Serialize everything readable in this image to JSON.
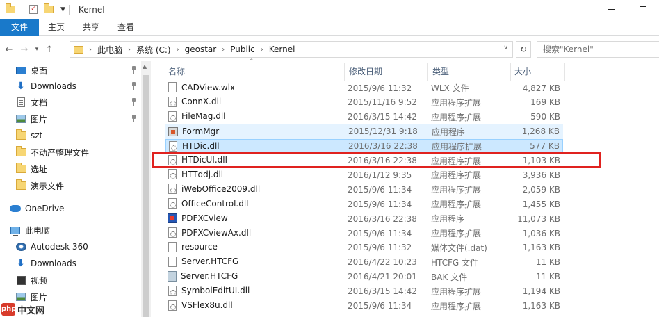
{
  "window": {
    "title": "Kernel"
  },
  "ribbon": {
    "tabs": [
      "文件",
      "主页",
      "共享",
      "查看"
    ]
  },
  "address": {
    "crumbs": [
      "此电脑",
      "系统 (C:)",
      "geostar",
      "Public",
      "Kernel"
    ],
    "search_placeholder": "搜索\"Kernel\""
  },
  "nav": {
    "items": [
      {
        "label": "桌面",
        "icon": "desktop-icon",
        "pinned": true
      },
      {
        "label": "Downloads",
        "icon": "download-icon",
        "pinned": true
      },
      {
        "label": "文档",
        "icon": "document-icon",
        "pinned": true
      },
      {
        "label": "图片",
        "icon": "pictures-icon",
        "pinned": true
      },
      {
        "label": "szt",
        "icon": "folder-icon",
        "pinned": false
      },
      {
        "label": "不动产整理文件",
        "icon": "folder-icon",
        "pinned": false
      },
      {
        "label": "选址",
        "icon": "folder-icon",
        "pinned": false
      },
      {
        "label": "演示文件",
        "icon": "folder-icon",
        "pinned": false
      },
      {
        "label": "OneDrive",
        "icon": "onedrive-icon",
        "pinned": false
      },
      {
        "label": "此电脑",
        "icon": "this-pc-icon",
        "pinned": false
      },
      {
        "label": "Autodesk 360",
        "icon": "autodesk-icon",
        "pinned": false
      },
      {
        "label": "Downloads",
        "icon": "download-icon",
        "pinned": false
      },
      {
        "label": "视频",
        "icon": "video-icon",
        "pinned": false
      },
      {
        "label": "图片",
        "icon": "pictures-icon",
        "pinned": false
      }
    ]
  },
  "columns": {
    "name": "名称",
    "date": "修改日期",
    "type": "类型",
    "size": "大小"
  },
  "files": [
    {
      "name": "CADView.wlx",
      "date": "2015/9/6 11:32",
      "type": "WLX 文件",
      "size": "4,827 KB",
      "icon": "file"
    },
    {
      "name": "ConnX.dll",
      "date": "2015/11/16 9:52",
      "type": "应用程序扩展",
      "size": "169 KB",
      "icon": "dll"
    },
    {
      "name": "FileMag.dll",
      "date": "2016/3/15 14:42",
      "type": "应用程序扩展",
      "size": "590 KB",
      "icon": "dll"
    },
    {
      "name": "FormMgr",
      "date": "2015/12/31 9:18",
      "type": "应用程序",
      "size": "1,268 KB",
      "icon": "exe"
    },
    {
      "name": "HTDic.dll",
      "date": "2016/3/16 22:38",
      "type": "应用程序扩展",
      "size": "577 KB",
      "icon": "dll"
    },
    {
      "name": "HTDicUI.dll",
      "date": "2016/3/16 22:38",
      "type": "应用程序扩展",
      "size": "1,103 KB",
      "icon": "dll"
    },
    {
      "name": "HTTddj.dll",
      "date": "2016/1/12 9:35",
      "type": "应用程序扩展",
      "size": "3,936 KB",
      "icon": "dll"
    },
    {
      "name": "iWebOffice2009.dll",
      "date": "2015/9/6 11:34",
      "type": "应用程序扩展",
      "size": "2,059 KB",
      "icon": "dll"
    },
    {
      "name": "OfficeControl.dll",
      "date": "2015/9/6 11:34",
      "type": "应用程序扩展",
      "size": "1,455 KB",
      "icon": "dll"
    },
    {
      "name": "PDFXCview",
      "date": "2016/3/16 22:38",
      "type": "应用程序",
      "size": "11,073 KB",
      "icon": "pdf"
    },
    {
      "name": "PDFXCviewAx.dll",
      "date": "2015/9/6 11:34",
      "type": "应用程序扩展",
      "size": "1,036 KB",
      "icon": "dll"
    },
    {
      "name": "resource",
      "date": "2015/9/6 11:32",
      "type": "媒体文件(.dat)",
      "size": "1,163 KB",
      "icon": "file"
    },
    {
      "name": "Server.HTCFG",
      "date": "2016/4/22 10:23",
      "type": "HTCFG 文件",
      "size": "11 KB",
      "icon": "file"
    },
    {
      "name": "Server.HTCFG",
      "date": "2016/4/21 20:01",
      "type": "BAK 文件",
      "size": "11 KB",
      "icon": "bak"
    },
    {
      "name": "SymbolEditUI.dll",
      "date": "2016/3/15 14:42",
      "type": "应用程序扩展",
      "size": "1,194 KB",
      "icon": "dll"
    },
    {
      "name": "VSFlex8u.dll",
      "date": "2015/9/6 11:34",
      "type": "应用程序扩展",
      "size": "1,163 KB",
      "icon": "dll"
    }
  ],
  "selected_row": 4,
  "hover_row": 3,
  "highlighted_row": 5,
  "watermark": {
    "logo_text": "php",
    "text": "中文网"
  },
  "colors": {
    "file_tab": "#1979ca",
    "selection": "#cce8ff",
    "highlight_box": "#e0221f"
  }
}
